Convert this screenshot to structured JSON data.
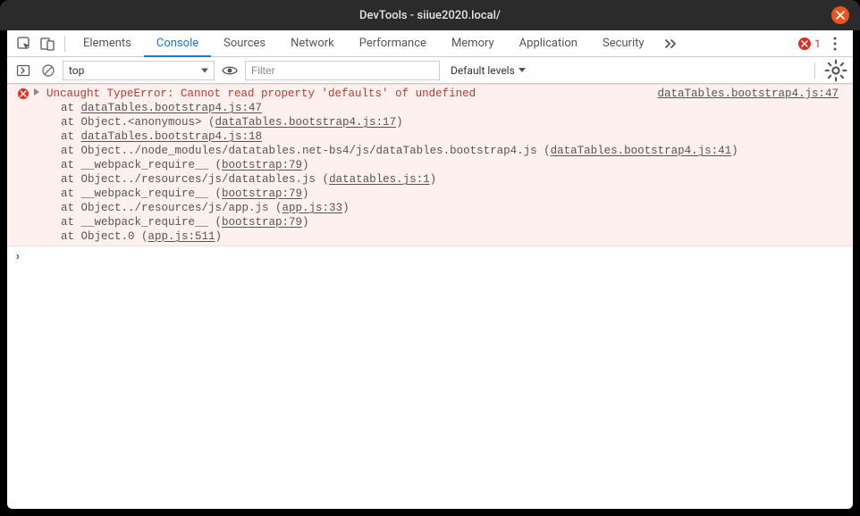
{
  "window": {
    "title": "DevTools - siiue2020.local/"
  },
  "tabs": [
    "Elements",
    "Console",
    "Sources",
    "Network",
    "Performance",
    "Memory",
    "Application",
    "Security"
  ],
  "active_tab_index": 1,
  "error_count": "1",
  "filter": {
    "context": "top",
    "filter_placeholder": "Filter",
    "levels": "Default levels"
  },
  "message": {
    "title": "Uncaught TypeError: Cannot read property 'defaults' of undefined",
    "source": "dataTables.bootstrap4.js:47",
    "stack": [
      {
        "prefix": "at ",
        "text": "",
        "link": "dataTables.bootstrap4.js:47",
        "suffix": ""
      },
      {
        "prefix": "at Object.<anonymous> (",
        "text": "",
        "link": "dataTables.bootstrap4.js:17",
        "suffix": ")"
      },
      {
        "prefix": "at ",
        "text": "",
        "link": "dataTables.bootstrap4.js:18",
        "suffix": ""
      },
      {
        "prefix": "at Object../node_modules/datatables.net-bs4/js/dataTables.bootstrap4.js (",
        "text": "",
        "link": "dataTables.bootstrap4.js:41",
        "suffix": ")"
      },
      {
        "prefix": "at __webpack_require__ (",
        "text": "",
        "link": "bootstrap:79",
        "suffix": ")"
      },
      {
        "prefix": "at Object../resources/js/datatables.js (",
        "text": "",
        "link": "datatables.js:1",
        "suffix": ")"
      },
      {
        "prefix": "at __webpack_require__ (",
        "text": "",
        "link": "bootstrap:79",
        "suffix": ")"
      },
      {
        "prefix": "at Object../resources/js/app.js (",
        "text": "",
        "link": "app.js:33",
        "suffix": ")"
      },
      {
        "prefix": "at __webpack_require__ (",
        "text": "",
        "link": "bootstrap:79",
        "suffix": ")"
      },
      {
        "prefix": "at Object.0 (",
        "text": "",
        "link": "app.js:511",
        "suffix": ")"
      }
    ]
  }
}
